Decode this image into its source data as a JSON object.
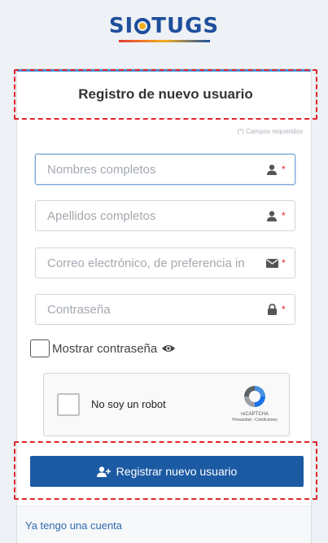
{
  "brand": {
    "logo_text_left": "SI",
    "logo_text_right": "TUGS",
    "logo_subtitle": ""
  },
  "header": {
    "title": "Registro de nuevo usuario"
  },
  "form": {
    "required_note": "(*) Campos requeridos",
    "fields": [
      {
        "placeholder": "Nombres completos",
        "icon": "user-icon"
      },
      {
        "placeholder": "Apellidos completos",
        "icon": "user-icon"
      },
      {
        "placeholder": "Correo electrónico, de preferencia in",
        "icon": "envelope-icon"
      },
      {
        "placeholder": "Contraseña",
        "icon": "lock-icon"
      }
    ],
    "required_marker": "*",
    "show_password_label": "Mostrar contraseña",
    "captcha": {
      "label": "No soy un robot",
      "brand": "reCAPTCHA",
      "links": "Privacidad - Condiciones"
    },
    "submit_label": "Registrar nuevo usuario"
  },
  "footer": {
    "login_link": "Ya tengo una cuenta"
  },
  "colors": {
    "primary": "#1c5aa3",
    "highlight_dash": "#e0242c",
    "link": "#2c6ab0"
  }
}
